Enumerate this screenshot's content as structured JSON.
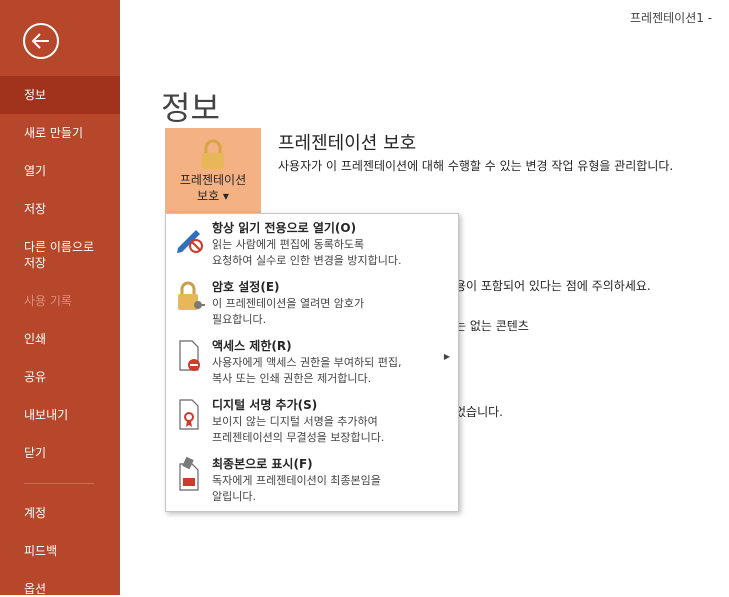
{
  "window": {
    "title": "프레젠테이션1  -"
  },
  "sidebar": {
    "items": [
      {
        "label": "정보"
      },
      {
        "label": "새로 만들기"
      },
      {
        "label": "열기"
      },
      {
        "label": "저장"
      },
      {
        "label": "다른 이름으로\n저장"
      },
      {
        "label": "사용 기록"
      },
      {
        "label": "인쇄"
      },
      {
        "label": "공유"
      },
      {
        "label": "내보내기"
      },
      {
        "label": "닫기"
      },
      {
        "label": "계정"
      },
      {
        "label": "피드백"
      },
      {
        "label": "옵션"
      }
    ]
  },
  "main": {
    "title": "정보",
    "protect": {
      "button_label": "프레젠테이션\n보호 ▾",
      "heading": "프레젠테이션 보호",
      "description": "사용자가 이 프레젠테이션에 대해 수행할 수 있는 변경 작업 유형을 관리합니다."
    },
    "background_fragments": [
      "용이 포함되어 있다는 점에 주의하세요.",
      "는 없는 콘텐츠",
      "었습니다."
    ]
  },
  "menu": {
    "items": [
      {
        "title": "항상 읽기 전용으로 열기(O)",
        "desc": "읽는 사람에게 편집에 동록하도록\n요청하여 실수로 인한 변경을 방지합니다."
      },
      {
        "title": "암호 설정(E)",
        "desc": "이 프레젠테이션을 열려면 암호가\n필요합니다."
      },
      {
        "title": "액세스 제한(R)",
        "desc": "사용자에게 액세스 권한을 부여하되 편집,\n복사 또는 인쇄 권한은 제거합니다.",
        "submenu_arrow": "▶"
      },
      {
        "title": "디지털 서명 추가(S)",
        "desc": "보이지 않는 디지털 서명을 추가하여\n프레젠테이션의 무결성을 보장합니다."
      },
      {
        "title": "최종본으로 표시(F)",
        "desc": "독자에게 프레젠테이션이 최종본임을\n알립니다."
      }
    ]
  },
  "colors": {
    "sidebar": "#b7472a",
    "sidebar_active": "#a1331c",
    "tile": "#f4b183"
  }
}
